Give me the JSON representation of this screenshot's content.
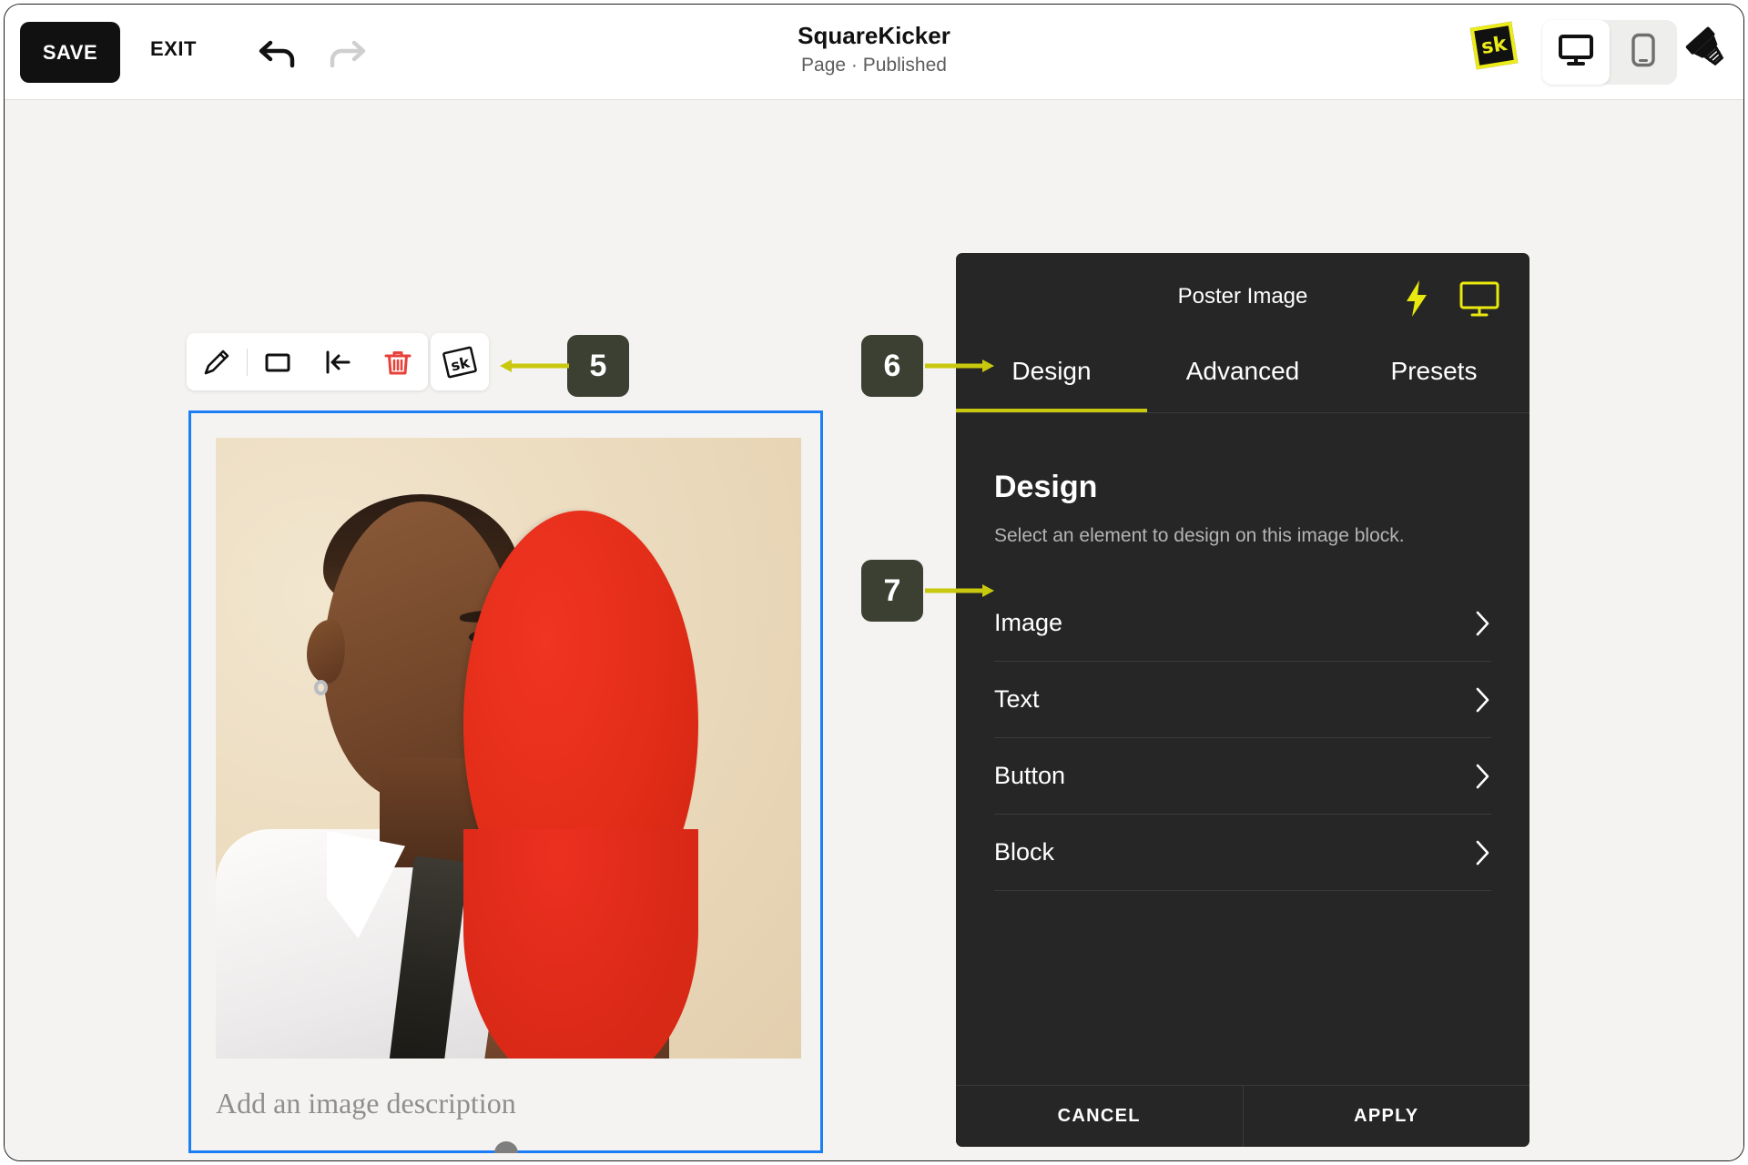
{
  "topbar": {
    "save_label": "SAVE",
    "exit_label": "EXIT",
    "undo_icon": "undo-arrow-icon",
    "redo_icon": "redo-arrow-icon",
    "title": "SquareKicker",
    "subtitle": "Page · Published",
    "logo_text": "sk",
    "desktop_icon": "desktop-monitor-icon",
    "mobile_icon": "mobile-phone-icon",
    "brush_icon": "paintbrush-icon"
  },
  "block_toolbar": {
    "items": [
      {
        "name": "edit-pencil-icon"
      },
      {
        "name": "crop-rectangle-icon"
      },
      {
        "name": "align-left-icon"
      },
      {
        "name": "delete-trash-icon"
      }
    ],
    "sk_button_text": "sk",
    "trash_color": "#e8413a"
  },
  "image_block": {
    "caption_placeholder": "Add an image description",
    "selection_color": "#1b7ef4",
    "handle_color": "#7e7e7e",
    "photo_alt": "Man in white shirt and tie holding a red oval paddle over half of his face"
  },
  "sk_panel": {
    "title": "Poster Image",
    "bolt_icon": "lightning-bolt-icon",
    "screen_icon": "desktop-monitor-icon",
    "accent_color": "#c8c80f",
    "tabs": [
      {
        "label": "Design",
        "active": true
      },
      {
        "label": "Advanced",
        "active": false
      },
      {
        "label": "Presets",
        "active": false
      }
    ],
    "section_title": "Design",
    "section_subtitle": "Select an element to design on this image block.",
    "options": [
      {
        "label": "Image"
      },
      {
        "label": "Text"
      },
      {
        "label": "Button"
      },
      {
        "label": "Block"
      }
    ],
    "cancel_label": "CANCEL",
    "apply_label": "APPLY"
  },
  "annotations": {
    "badge_color": "#3b4032",
    "arrow_color": "#c8c80f",
    "items": [
      {
        "number": "5",
        "points_to": "sk-block-button",
        "direction": "left"
      },
      {
        "number": "6",
        "points_to": "design-tab",
        "direction": "right"
      },
      {
        "number": "7",
        "points_to": "image-option-row",
        "direction": "right"
      }
    ]
  }
}
